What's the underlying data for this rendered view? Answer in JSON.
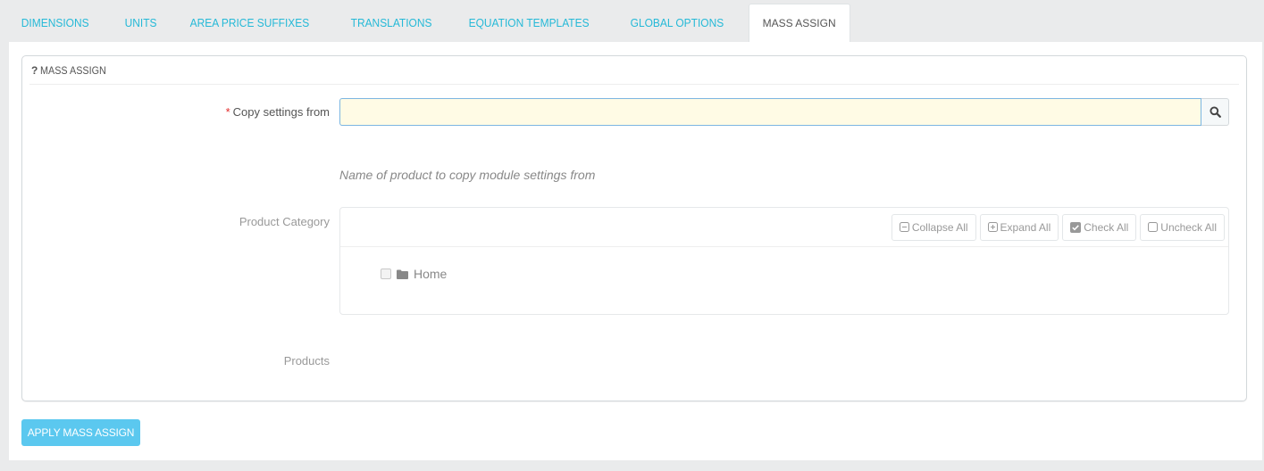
{
  "tabs": [
    {
      "label": "DIMENSIONS",
      "active": false
    },
    {
      "label": "UNITS",
      "active": false
    },
    {
      "label": "AREA PRICE SUFFIXES",
      "active": false
    },
    {
      "label": "TRANSLATIONS",
      "active": false
    },
    {
      "label": "EQUATION TEMPLATES",
      "active": false
    },
    {
      "label": "GLOBAL OPTIONS",
      "active": false
    },
    {
      "label": "MASS ASSIGN",
      "active": true
    }
  ],
  "panel": {
    "heading_icon": "?",
    "heading": "MASS ASSIGN"
  },
  "form": {
    "copy_settings": {
      "required_mark": "*",
      "label": "Copy settings from",
      "value": "",
      "placeholder": "",
      "search_icon": "search-icon",
      "help": "Name of product to copy module settings from"
    },
    "category": {
      "label": "Product Category",
      "toolbar": {
        "collapse_all": "Collapse All",
        "expand_all": "Expand All",
        "check_all": "Check All",
        "uncheck_all": "Uncheck All"
      },
      "nodes": [
        {
          "label": "Home",
          "checked": false,
          "icon": "folder-icon"
        }
      ]
    },
    "products": {
      "label": "Products"
    }
  },
  "actions": {
    "apply_label": "APPLY MASS ASSIGN"
  },
  "colors": {
    "accent": "#25b9d7",
    "button": "#5bc8ef",
    "required": "#e32b2b",
    "input_bg": "#fffbe5"
  }
}
